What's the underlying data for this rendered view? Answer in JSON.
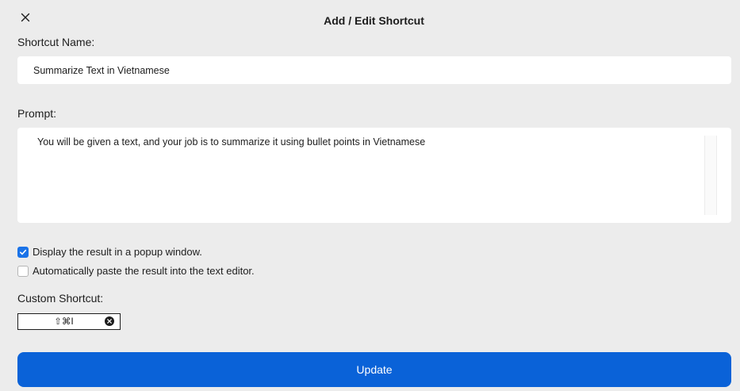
{
  "dialog": {
    "title": "Add / Edit Shortcut",
    "close_icon": "close-icon"
  },
  "shortcut_name": {
    "label": "Shortcut Name:",
    "value": "Summarize Text in Vietnamese"
  },
  "prompt": {
    "label": "Prompt:",
    "value": "You will be given a text, and your job is to summarize it using bullet points in Vietnamese"
  },
  "options": [
    {
      "label": "Display the result in a popup window.",
      "checked": true
    },
    {
      "label": "Automatically paste the result into the text editor.",
      "checked": false
    }
  ],
  "custom_shortcut": {
    "label": "Custom Shortcut:",
    "keys": "⇧⌘I",
    "clear_icon": "clear-circle-icon"
  },
  "update_button": {
    "label": "Update"
  },
  "colors": {
    "accent": "#0a62d8",
    "checkbox_checked": "#1a73e8",
    "background": "#ececec"
  }
}
